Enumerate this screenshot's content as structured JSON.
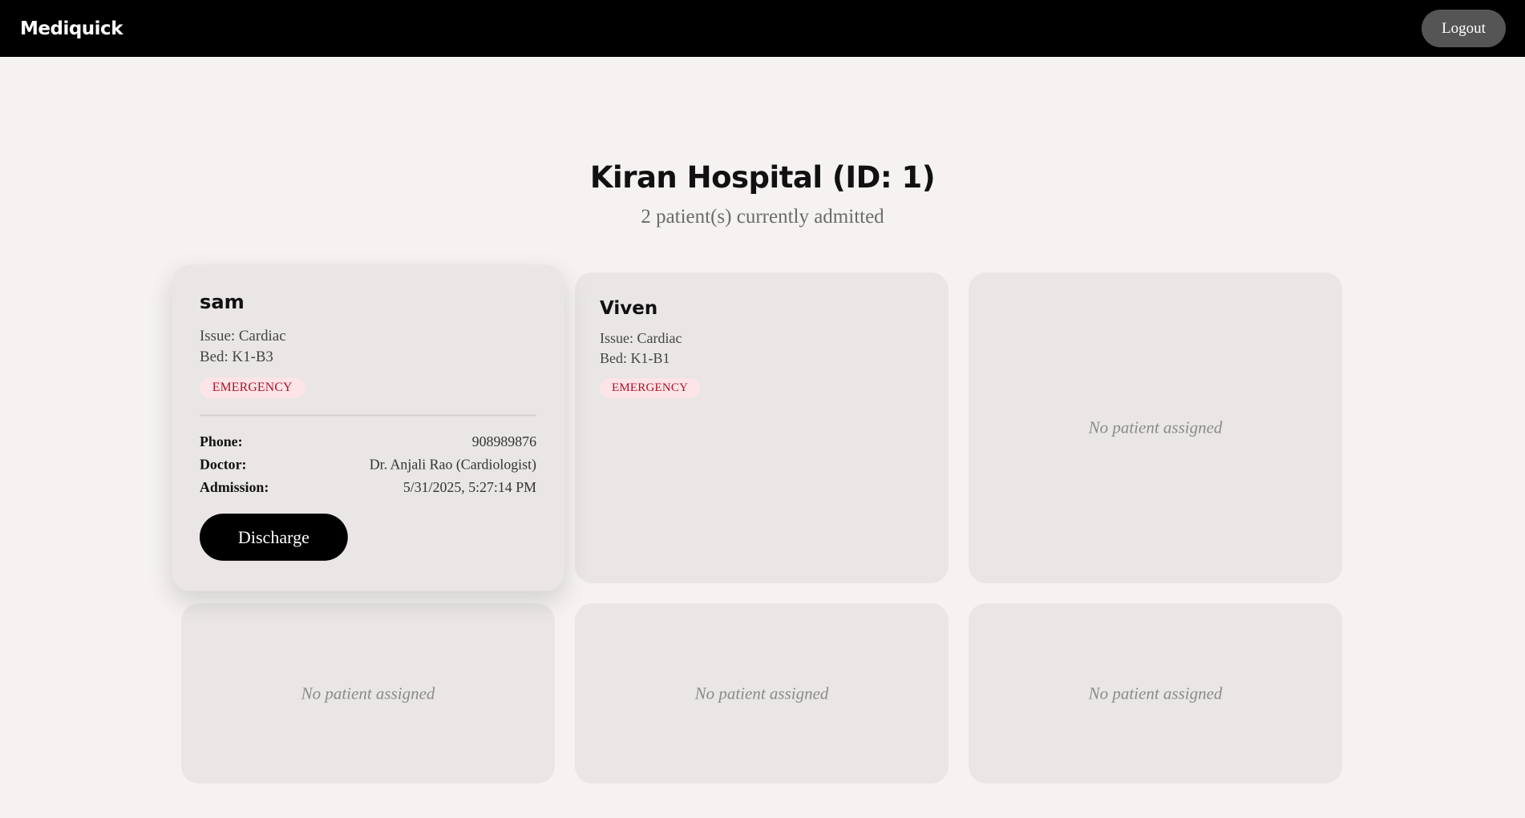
{
  "navbar": {
    "brand": "Mediquick",
    "logout_label": "Logout"
  },
  "header": {
    "title": "Kiran Hospital (ID: 1)",
    "subtitle": "2 patient(s) currently admitted"
  },
  "beds": [
    {
      "name": "sam",
      "issue": "Issue: Cardiac",
      "bed": "Bed: K1-B3",
      "badge": "EMERGENCY",
      "details": {
        "phone_label": "Phone:",
        "phone": "908989876",
        "doctor_label": "Doctor:",
        "doctor": "Dr. Anjali Rao (Cardiologist)",
        "admission_label": "Admission:",
        "admission": "5/31/2025, 5:27:14 PM"
      },
      "action_label": "Discharge"
    },
    {
      "name": "Viven",
      "issue": "Issue: Cardiac",
      "bed": "Bed: K1-B1",
      "badge": "EMERGENCY"
    },
    {
      "empty_text": "No patient assigned"
    },
    {
      "empty_text": "No patient assigned"
    },
    {
      "empty_text": "No patient assigned"
    },
    {
      "empty_text": "No patient assigned"
    }
  ],
  "colors": {
    "navbar_bg": "#000000",
    "page_bg": "#f5f2f1",
    "card_bg": "#e9e6e5",
    "badge_bg": "#fde4e6",
    "badge_text": "#b0122a",
    "logout_bg": "#555555"
  }
}
